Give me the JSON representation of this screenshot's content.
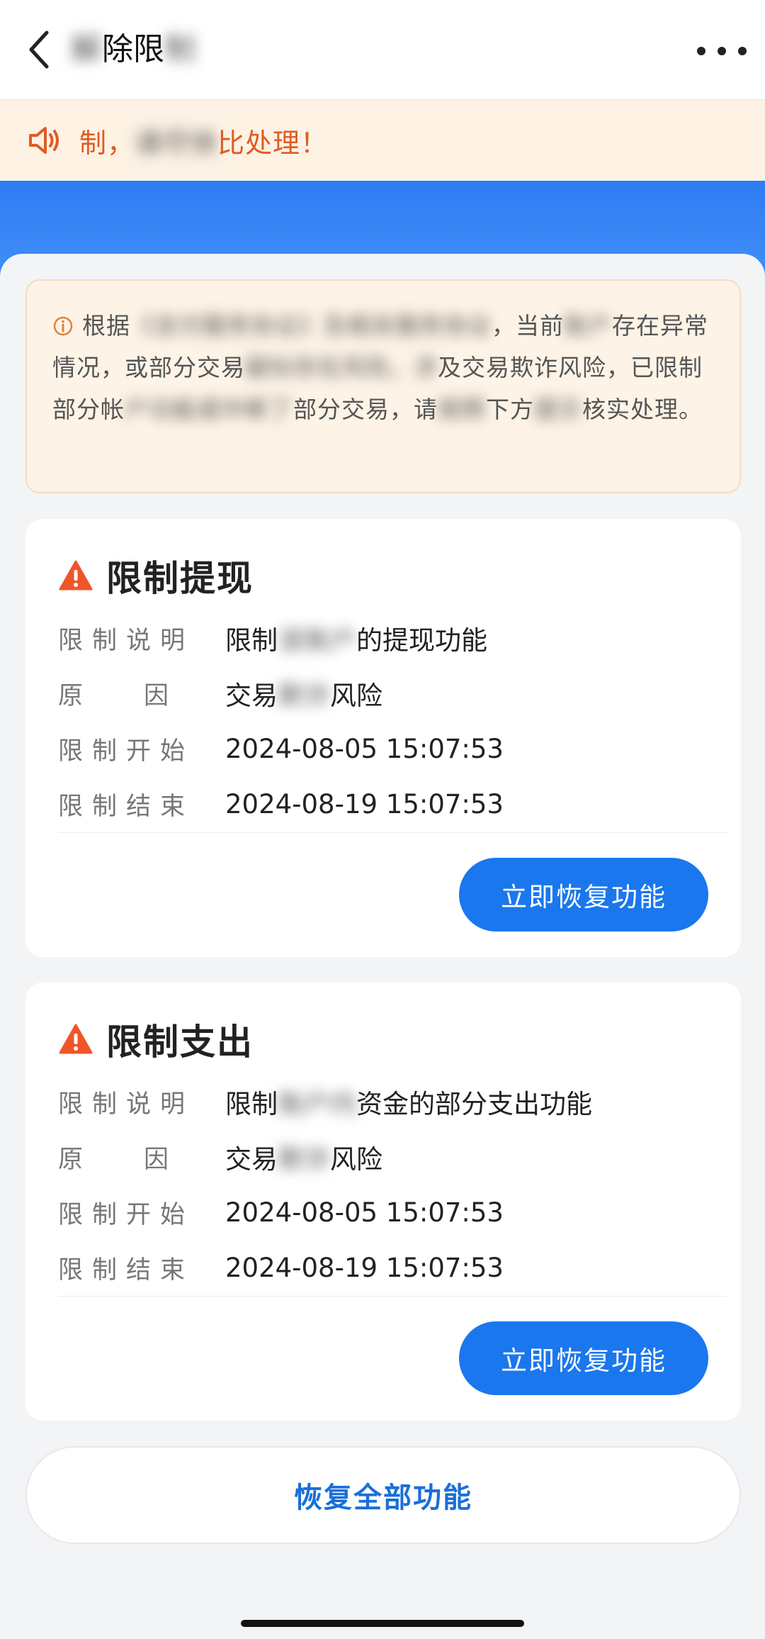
{
  "nav": {
    "title_blur_prefix": "解",
    "title_visible": "除限",
    "title_blur_suffix": "制"
  },
  "notice": {
    "visible_lead": "制，",
    "blur_middle": "请尽快",
    "visible_tail": "比处理！"
  },
  "tip": {
    "text_visible_1": "根据",
    "text_blur_1": "《支付服务协议》及相关服务协议",
    "text_visible_2": "，当前",
    "text_blur_2": "账户",
    "text_visible_3": "存在异常情况，或部分交易",
    "text_blur_3": "疑似存在风险，涉",
    "text_visible_4": "及交易欺诈风险，已限制部分帐",
    "text_blur_4": "户功能或中断了",
    "text_visible_5": "部分交易，请",
    "text_blur_5": "按照",
    "text_visible_6": "下方",
    "text_blur_6": "提示",
    "text_visible_7": "核实处理。"
  },
  "cards": [
    {
      "title": "限制提现",
      "rows": [
        {
          "key": "限制说明",
          "v_pre": "限制",
          "v_blur": "该账户",
          "v_post": "的提现功能"
        },
        {
          "key": "原因",
          "v_pre": "交易",
          "v_blur": "欺诈",
          "v_post": "风险"
        },
        {
          "key": "限制开始",
          "v_pre": "2024-08-05 15:07:53",
          "v_blur": "",
          "v_post": ""
        },
        {
          "key": "限制结束",
          "v_pre": "2024-08-19 15:07:53",
          "v_blur": "",
          "v_post": ""
        }
      ],
      "button": "立即恢复功能"
    },
    {
      "title": "限制支出",
      "rows": [
        {
          "key": "限制说明",
          "v_pre": "限制",
          "v_blur": "账户内",
          "v_post": "资金的部分支出功能"
        },
        {
          "key": "原因",
          "v_pre": "交易",
          "v_blur": "欺诈",
          "v_post": "风险"
        },
        {
          "key": "限制开始",
          "v_pre": "2024-08-05 15:07:53",
          "v_blur": "",
          "v_post": ""
        },
        {
          "key": "限制结束",
          "v_pre": "2024-08-19 15:07:53",
          "v_blur": "",
          "v_post": ""
        }
      ],
      "button": "立即恢复功能"
    }
  ],
  "restore_all": "恢复全部功能",
  "colors": {
    "accent_blue": "#1a77ee",
    "notice_orange": "#e25a22",
    "warning_red": "#f0552a"
  }
}
